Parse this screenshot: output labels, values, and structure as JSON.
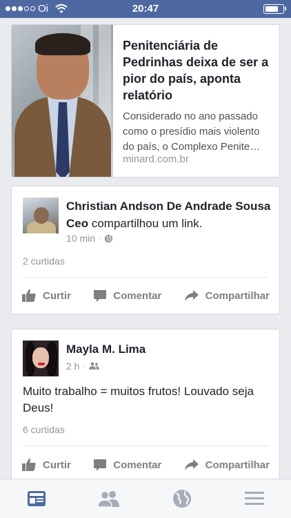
{
  "status_bar": {
    "carrier": "Oi",
    "time": "20:47",
    "signal_bars_filled": 3,
    "signal_bars_total": 5,
    "battery_level": 0.8
  },
  "link_preview": {
    "title": "Penitenciária de Pedrinhas deixa de ser a pior do país, aponta relatório",
    "description_lines": [
      "Considerado no ano passado",
      "como o presídio mais violento",
      "do país, o Complexo Penite…"
    ],
    "domain": "minard.com.br"
  },
  "posts": [
    {
      "author": "Christian Andson De Andrade Sousa Ceo",
      "action": " compartilhou um link.",
      "time": "10 min",
      "privacy_icon": "globe-icon",
      "text": "",
      "likes": "2 curtidas",
      "actions": {
        "like": "Curtir",
        "comment": "Comentar",
        "share": "Compartilhar"
      }
    },
    {
      "author": "Mayla M. Lima",
      "action": "",
      "time": "2 h",
      "privacy_icon": "friends-icon",
      "text": "Muito trabalho = muitos frutos! Louvado seja Deus!",
      "likes": "6 curtidas",
      "actions": {
        "like": "Curtir",
        "comment": "Comentar",
        "share": "Compartilhar"
      }
    }
  ],
  "tab_bar": {
    "tabs": [
      "news-feed-icon",
      "friends-icon",
      "globe-icon",
      "menu-icon"
    ],
    "active_tab": "news-feed-icon",
    "active_color": "#4e69a2",
    "inactive_color": "#a6acb8"
  }
}
